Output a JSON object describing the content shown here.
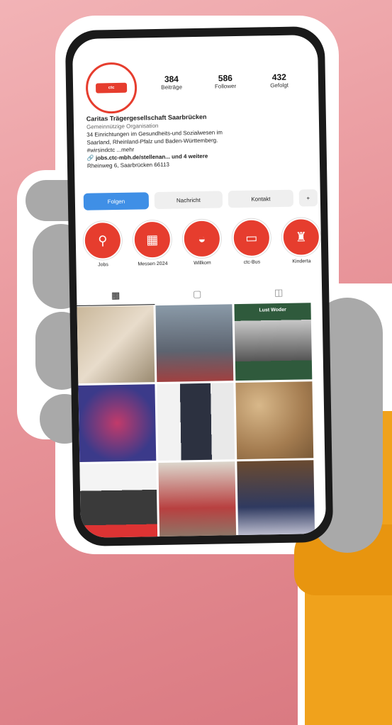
{
  "profile": {
    "stats": [
      {
        "num": "384",
        "label": "Beiträge"
      },
      {
        "num": "586",
        "label": "Follower"
      },
      {
        "num": "432",
        "label": "Gefolgt"
      }
    ],
    "name": "Caritas Trägergesellschaft Saarbrücken",
    "category": "Gemeinnützige Organisation",
    "bio1": "34 Einrichtungen im Gesundheits-und Sozialwesen im",
    "bio2": "Saarland, Rheinland-Pfalz und Baden-Württemberg.",
    "bio3": "#wirsindctc ...mehr",
    "link": "jobs.ctc-mbh.de/stellenan... und 4 weitere",
    "address": "Rheinweg 6, Saarbrücken 66113"
  },
  "buttons": {
    "follow": "Folgen",
    "message": "Nachricht",
    "contact": "Kontakt"
  },
  "highlights": [
    {
      "label": "Jobs",
      "icon": "briefcase-icon"
    },
    {
      "label": "Messen 2024",
      "icon": "calendar-icon"
    },
    {
      "label": "Willkom",
      "icon": "car-icon"
    },
    {
      "label": "ctc-Bus",
      "icon": "bus-icon"
    },
    {
      "label": "Kinderta",
      "icon": "lamp-icon"
    }
  ],
  "grid_tiles": {
    "tile3_top": "Lust Woder"
  },
  "colors": {
    "accent": "#e63d2e",
    "follow": "#3f8fe6",
    "sleeve": "#f0a21c",
    "background": "#e8959a"
  }
}
